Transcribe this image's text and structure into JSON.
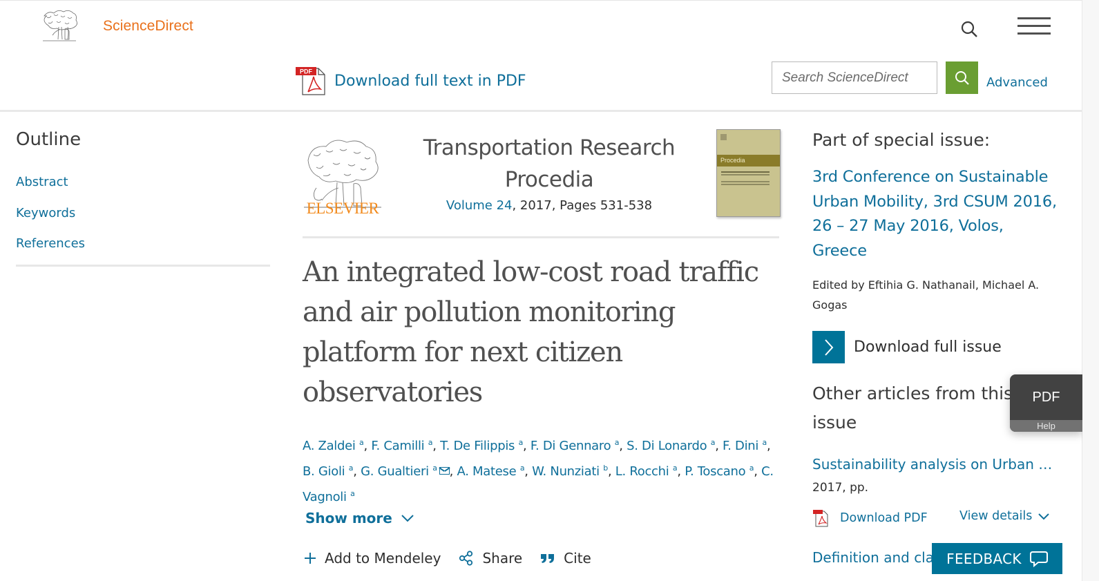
{
  "header": {
    "brand": "ScienceDirect",
    "download_pdf_label": "Download full text in PDF",
    "pdf_badge": "PDF",
    "search_placeholder": "Search ScienceDirect",
    "advanced_label": "Advanced",
    "icons": {
      "top_search": "search-icon",
      "menu": "hamburger-menu-icon",
      "search_button": "search-icon",
      "logo": "elsevier-tree-logo"
    }
  },
  "outline": {
    "title": "Outline",
    "items": [
      {
        "label": "Abstract"
      },
      {
        "label": "Keywords"
      },
      {
        "label": "References"
      }
    ]
  },
  "journal": {
    "publisher": "ELSEVIER",
    "title_line1": "Transportation Research",
    "title_line2": "Procedia",
    "volume_link": "Volume 24",
    "meta_rest": ", 2017, Pages 531-538",
    "cover_text": "Procedia"
  },
  "article": {
    "title": "An integrated low-cost road traffic and air pollution monitoring platform for next citizen observatories",
    "authors": [
      {
        "name": "A. Zaldei",
        "aff": "a"
      },
      {
        "name": "F. Camilli",
        "aff": "a"
      },
      {
        "name": "T. De Filippis",
        "aff": "a"
      },
      {
        "name": "F. Di Gennaro",
        "aff": "a"
      },
      {
        "name": "S. Di Lonardo",
        "aff": "a"
      },
      {
        "name": "F. Dini",
        "aff": "a"
      },
      {
        "name": "B. Gioli",
        "aff": "a"
      },
      {
        "name": "G. Gualtieri",
        "aff": "a",
        "corresponding": true
      },
      {
        "name": "A. Matese",
        "aff": "a"
      },
      {
        "name": "W. Nunziati",
        "aff": "b"
      },
      {
        "name": "L. Rocchi",
        "aff": "a"
      },
      {
        "name": "P. Toscano",
        "aff": "a"
      },
      {
        "name": "C. Vagnoli",
        "aff": "a"
      }
    ],
    "show_more": "Show more",
    "actions": {
      "mendeley": "Add to Mendeley",
      "share": "Share",
      "cite": "Cite"
    }
  },
  "sidebar": {
    "special_issue_heading": "Part of special issue:",
    "special_issue_link": "3rd Conference on Sustainable Urban Mobility, 3rd CSUM 2016, 26 – 27 May 2016, Volos, Greece",
    "edited_by": "Edited by Eftihia G. Nathanail, Michael A. Gogas",
    "download_issue": "Download full issue",
    "other_articles_heading": "Other articles from this issue",
    "related": [
      {
        "title": "Sustainability analysis on Urban …",
        "meta": "2017, pp.",
        "download_pdf": "Download PDF",
        "view_details": "View details"
      },
      {
        "title": "Definition and cla"
      }
    ]
  },
  "widgets": {
    "pdf_help_top": "PDF",
    "pdf_help_bottom": "Help",
    "feedback": "FEEDBACK"
  },
  "colors": {
    "brand_orange": "#e9711c",
    "link_blue": "#0f6f9a",
    "search_green": "#6a9e32",
    "teal": "#007398",
    "elsevier_orange": "#f28a1c"
  }
}
